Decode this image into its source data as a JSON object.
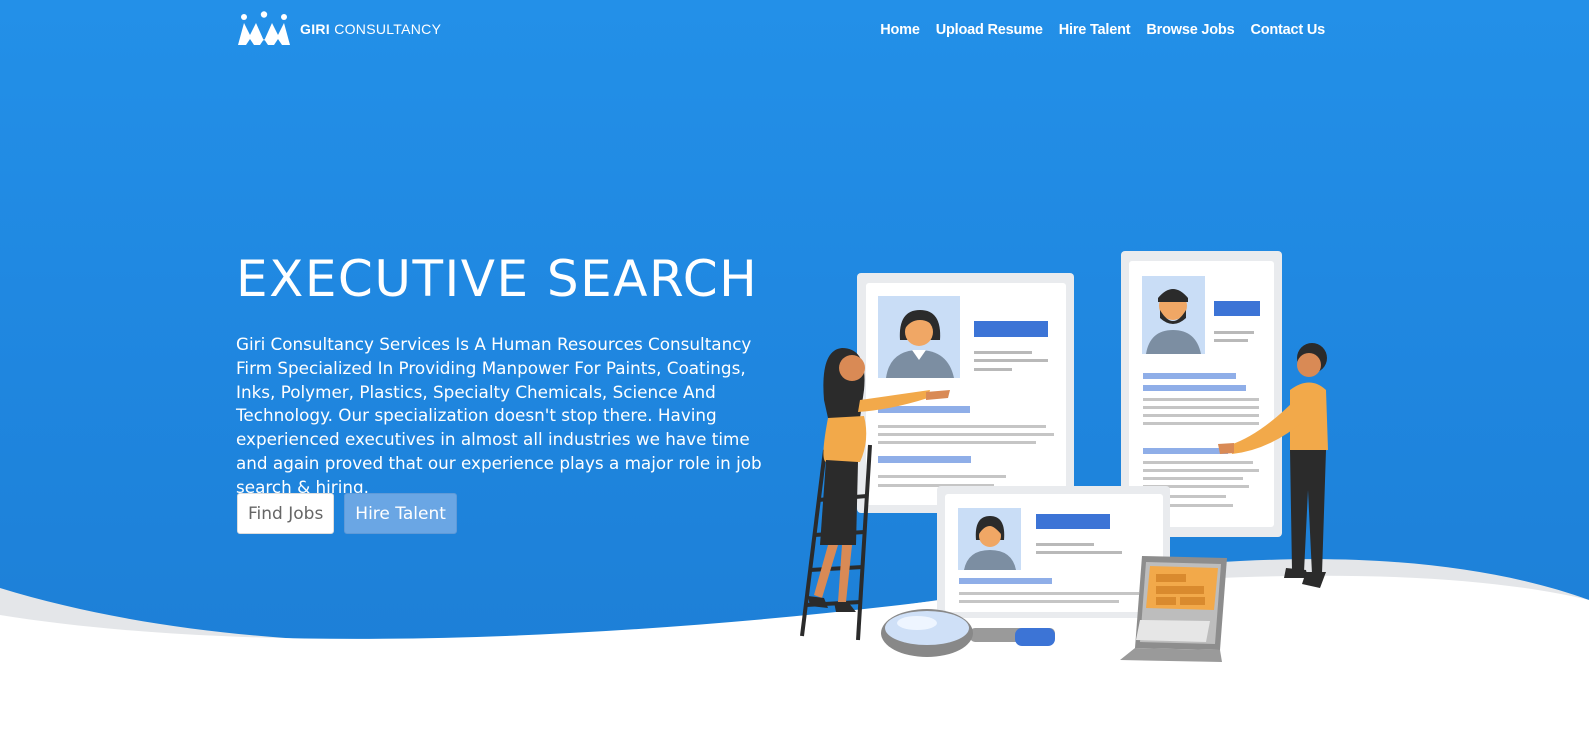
{
  "brand": {
    "name_bold": "GIRI",
    "name_rest": "CONSULTANCY",
    "logo_icon": "people-crown-icon"
  },
  "nav": {
    "items": [
      {
        "label": "Home"
      },
      {
        "label": "Upload Resume"
      },
      {
        "label": "Hire Talent"
      },
      {
        "label": "Browse Jobs"
      },
      {
        "label": "Contact Us"
      }
    ]
  },
  "hero": {
    "title": "EXECUTIVE SEARCH",
    "description": "Giri Consultancy Services Is A Human Resources Consultancy Firm Specialized In Providing Manpower For Paints, Coatings, Inks, Polymer, Plastics, Specialty Chemicals, Science And Technology. Our specialization doesn't stop there. Having experienced executives in almost all industries we have time and again proved that our experience plays a major role in job search & hiring.",
    "find_jobs_label": "Find Jobs",
    "hire_talent_label": "Hire Talent"
  },
  "colors": {
    "hero_blue": "#2390e8",
    "accent_orange": "#f2a94a",
    "card_blue": "#3c74d6",
    "button_light_blue": "#6aa6e4"
  }
}
